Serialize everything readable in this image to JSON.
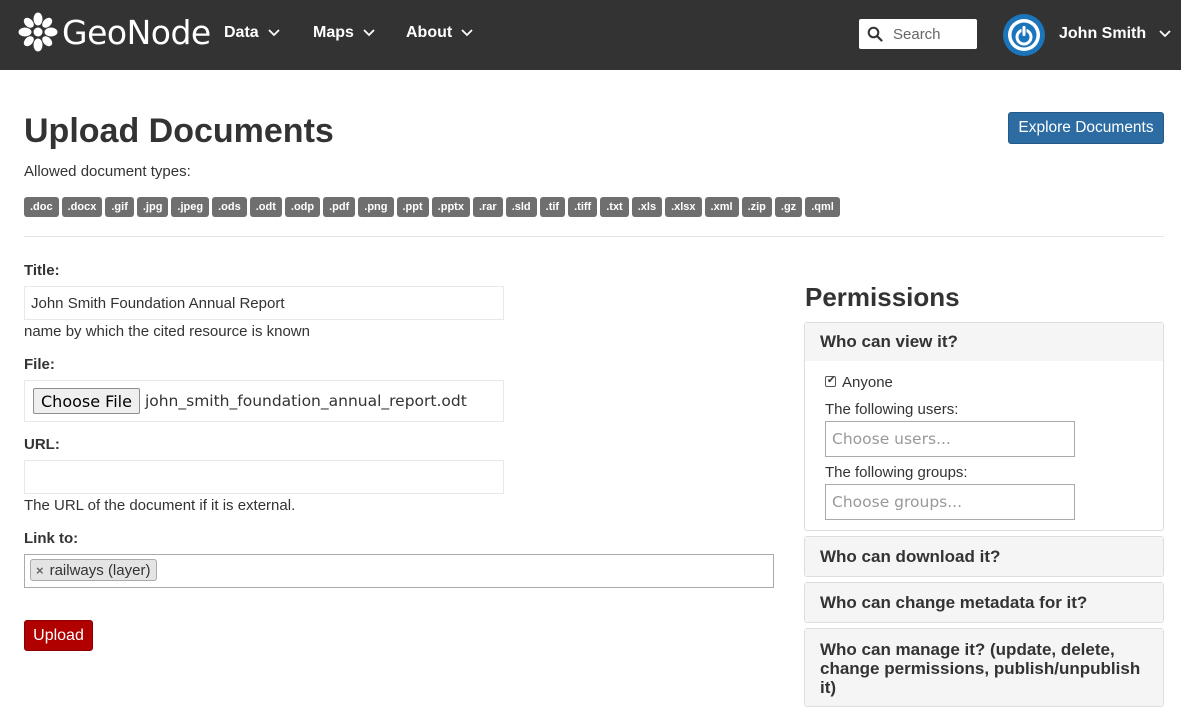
{
  "navbar": {
    "brand": "GeoNode",
    "items": [
      {
        "label": "Data"
      },
      {
        "label": "Maps"
      },
      {
        "label": "About"
      }
    ],
    "search_placeholder": "Search",
    "user_name": "John Smith"
  },
  "header": {
    "title": "Upload Documents",
    "explore_label": "Explore Documents",
    "allowed_label": "Allowed document types:",
    "types": [
      ".doc",
      ".docx",
      ".gif",
      ".jpg",
      ".jpeg",
      ".ods",
      ".odt",
      ".odp",
      ".pdf",
      ".png",
      ".ppt",
      ".pptx",
      ".rar",
      ".sld",
      ".tif",
      ".tiff",
      ".txt",
      ".xls",
      ".xlsx",
      ".xml",
      ".zip",
      ".gz",
      ".qml"
    ]
  },
  "form": {
    "title_label": "Title:",
    "title_value": "John Smith Foundation Annual Report",
    "title_help": "name by which the cited resource is known",
    "file_label": "File:",
    "choose_file_label": "Choose File",
    "file_name": "john_smith_foundation_annual_report.odt",
    "url_label": "URL:",
    "url_value": "",
    "url_help": "The URL of the document if it is external.",
    "link_label": "Link to:",
    "link_tag": "railways (layer)",
    "link_tag_remove": "×",
    "upload_label": "Upload"
  },
  "permissions": {
    "title": "Permissions",
    "view_heading": "Who can view it?",
    "anyone_label": "Anyone",
    "anyone_checked": true,
    "users_label": "The following users:",
    "users_placeholder": "Choose users...",
    "groups_label": "The following groups:",
    "groups_placeholder": "Choose groups...",
    "download_heading": "Who can download it?",
    "metadata_heading": "Who can change metadata for it?",
    "manage_heading": "Who can manage it? (update, delete, change permissions, publish/unpublish it)"
  },
  "colors": {
    "navbar": "#333333",
    "explore_button": "#2c6ca3",
    "upload_button": "#b00000",
    "type_badge": "#6f6f6f"
  }
}
